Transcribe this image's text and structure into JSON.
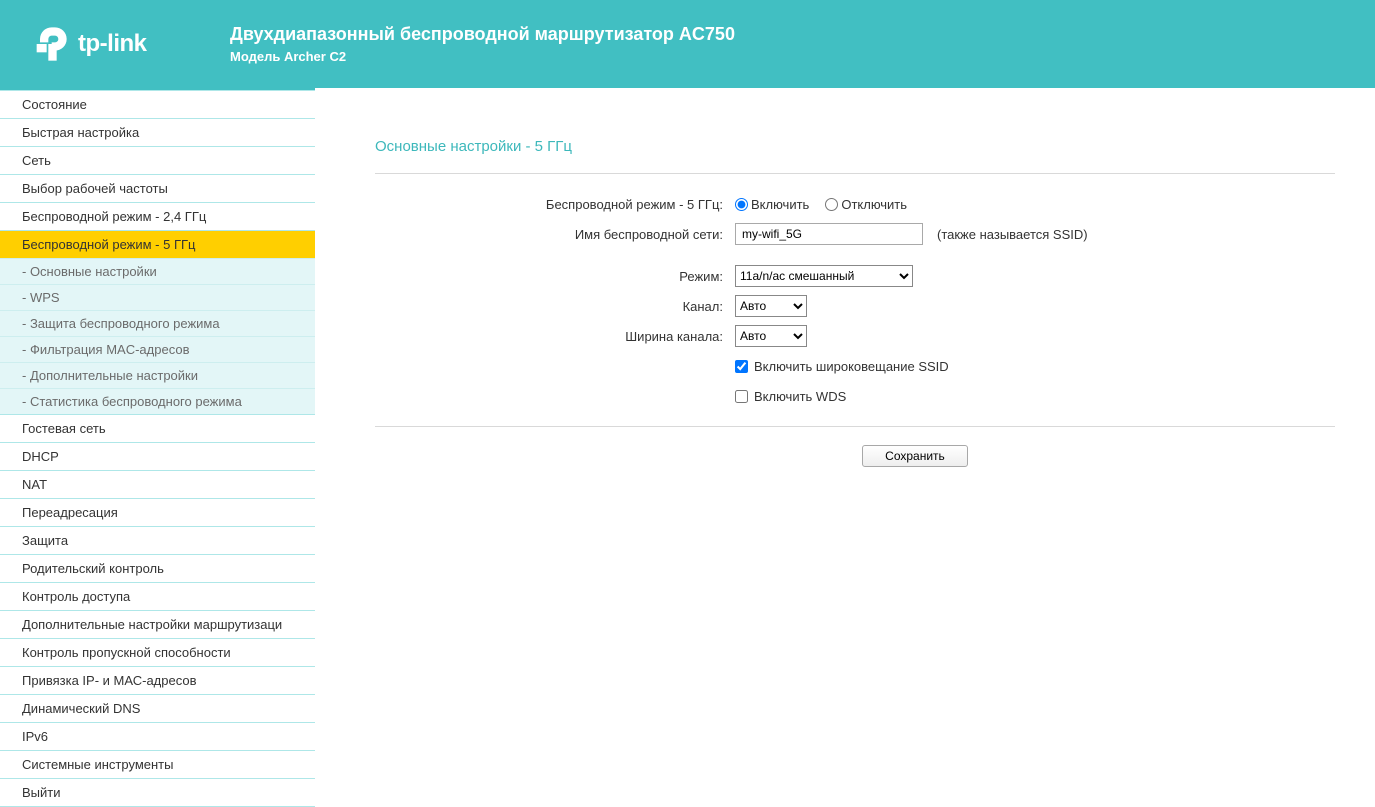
{
  "header": {
    "brand": "tp-link",
    "title": "Двухдиапазонный беспроводной маршрутизатор AC750",
    "subtitle": "Модель Archer C2"
  },
  "sidebar": {
    "items": [
      {
        "label": "Состояние"
      },
      {
        "label": "Быстрая настройка"
      },
      {
        "label": "Сеть"
      },
      {
        "label": "Выбор рабочей частоты"
      },
      {
        "label": "Беспроводной режим - 2,4 ГГц"
      },
      {
        "label": "Беспроводной режим - 5 ГГц",
        "selected": true,
        "sub": [
          {
            "label": "- Основные настройки"
          },
          {
            "label": "- WPS"
          },
          {
            "label": "- Защита беспроводного режима"
          },
          {
            "label": "- Фильтрация MAC-адресов"
          },
          {
            "label": "- Дополнительные настройки"
          },
          {
            "label": "- Статистика беспроводного режима"
          }
        ]
      },
      {
        "label": "Гостевая сеть"
      },
      {
        "label": "DHCP"
      },
      {
        "label": "NAT"
      },
      {
        "label": "Переадресация"
      },
      {
        "label": "Защита"
      },
      {
        "label": "Родительский контроль"
      },
      {
        "label": "Контроль доступа"
      },
      {
        "label": "Дополнительные настройки маршрутизаци"
      },
      {
        "label": "Контроль пропускной способности"
      },
      {
        "label": "Привязка IP- и МАС-адресов"
      },
      {
        "label": "Динамический DNS"
      },
      {
        "label": "IPv6"
      },
      {
        "label": "Системные инструменты"
      },
      {
        "label": "Выйти"
      }
    ]
  },
  "main": {
    "section_title": "Основные настройки - 5 ГГц",
    "labels": {
      "wireless_mode": "Беспроводной режим - 5 ГГц:",
      "ssid": "Имя беспроводной сети:",
      "mode": "Режим:",
      "channel": "Канал:",
      "width": "Ширина канала:"
    },
    "radio": {
      "enable": "Включить",
      "disable": "Отключить"
    },
    "ssid_value": "my-wifi_5G",
    "ssid_hint": "(также называется SSID)",
    "mode_value": "11a/n/ac смешанный",
    "channel_value": "Авто",
    "width_value": "Авто",
    "broadcast_label": "Включить широковещание SSID",
    "wds_label": "Включить WDS",
    "save_label": "Сохранить"
  }
}
